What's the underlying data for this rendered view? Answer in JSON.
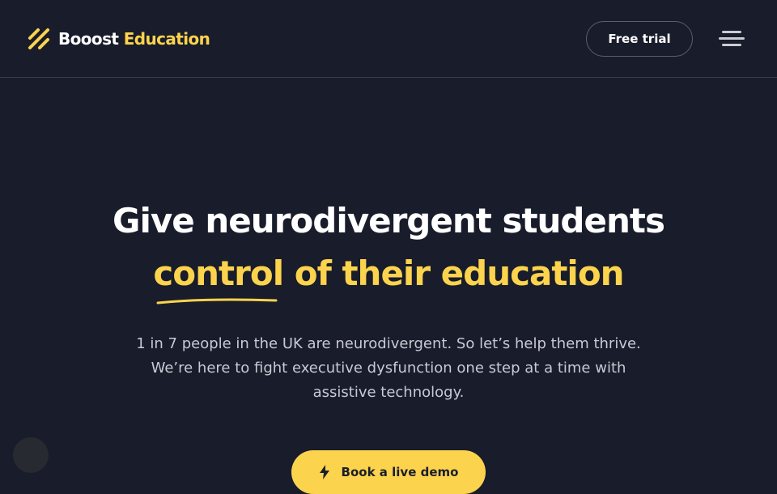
{
  "header": {
    "logo_word1": "Booost",
    "logo_word2": "Education",
    "free_trial_label": "Free trial",
    "menu_icon": "hamburger-menu-icon"
  },
  "hero": {
    "title_line1": "Give neurodivergent students",
    "title_line2": "control of their education",
    "subtitle_lines": [
      "1 in 7 people in the UK are neurodivergent. So let’s help them thrive.",
      "We’re here to fight executive dysfunction one step at a time with",
      "assistive technology."
    ],
    "cta_label": "Book a live demo",
    "cta_icon": "lightning-icon"
  },
  "colors": {
    "background": "#181c2b",
    "accent": "#fcd34d",
    "text": "#ffffff",
    "muted_text": "#c7cad3"
  }
}
